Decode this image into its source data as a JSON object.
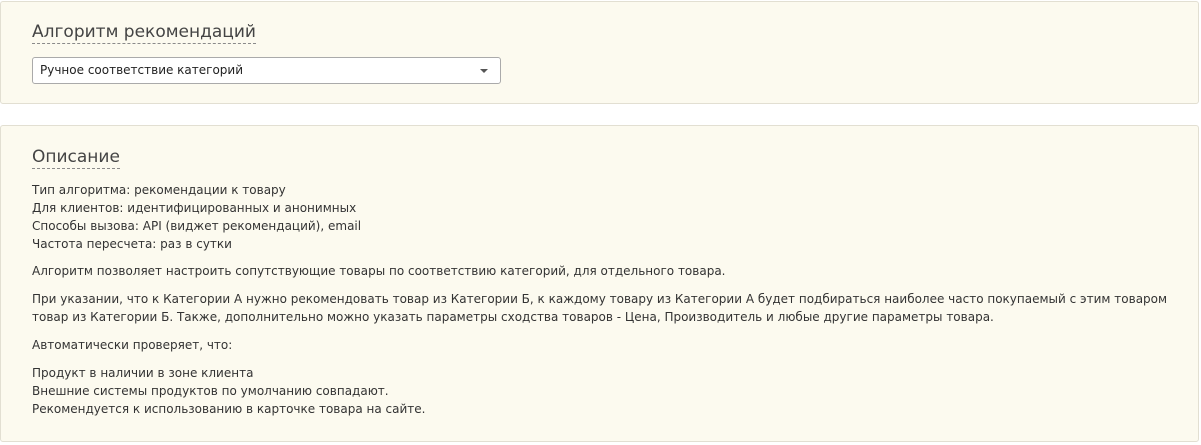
{
  "algorithm_panel": {
    "title": "Алгоритм рекомендаций",
    "select": {
      "value": "Ручное соответствие категорий",
      "caret_icon": "chevron-down-icon"
    }
  },
  "description_panel": {
    "title": "Описание",
    "meta": [
      "Тип алгоритма: рекомендации к товару",
      "Для клиентов: идентифицированных и анонимных",
      "Способы вызова: API (виджет рекомендаций), email",
      "Частота пересчета: раз в сутки"
    ],
    "paragraph_1": "Алгоритм позволяет настроить сопутствующие товары по соответствию категорий, для отдельного товара.",
    "paragraph_2": "При указании, что к Категории А нужно рекомендовать товар из Категории Б, к каждому товару из Категории А будет подбираться наиболее часто покупаемый с этим товаром товар из Категории Б. Также, дополнительно можно указать параметры сходства товаров - Цена, Производитель и любые другие параметры товара.",
    "checks_heading": "Автоматически проверяет, что:",
    "checks": [
      "Продукт в наличии в зоне клиента",
      "Внешние системы продуктов по умолчанию совпадают.",
      "Рекомендуется к использованию в карточке товара на сайте."
    ]
  }
}
